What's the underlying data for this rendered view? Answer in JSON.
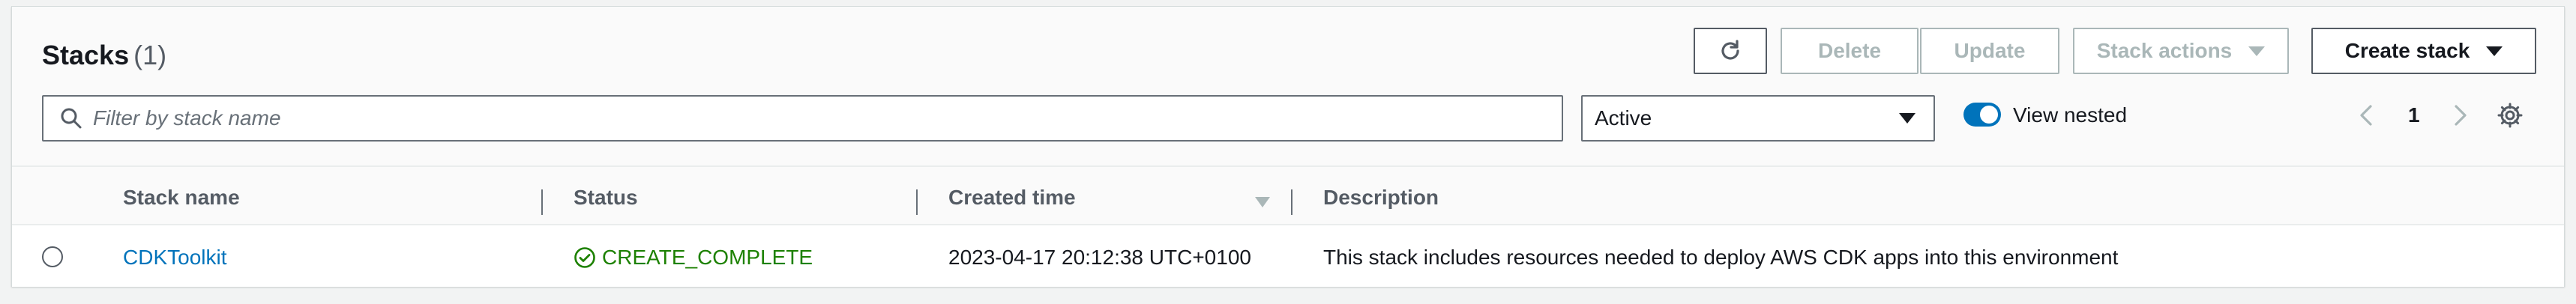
{
  "header": {
    "title": "Stacks",
    "count": "(1)"
  },
  "toolbar": {
    "refresh_icon": "refresh-icon",
    "delete_label": "Delete",
    "update_label": "Update",
    "stack_actions_label": "Stack actions",
    "create_stack_label": "Create stack"
  },
  "filter": {
    "placeholder": "Filter by stack name",
    "value": ""
  },
  "status_filter": {
    "selected": "Active"
  },
  "view_nested": {
    "label": "View nested",
    "enabled": true
  },
  "pagination": {
    "current_page": "1"
  },
  "table": {
    "columns": [
      "Stack name",
      "Status",
      "Created time",
      "Description"
    ],
    "rows": [
      {
        "stack_name": "CDKToolkit",
        "status": "CREATE_COMPLETE",
        "created_time": "2023-04-17 20:12:38 UTC+0100",
        "description": "This stack includes resources needed to deploy AWS CDK apps into this environment"
      }
    ]
  },
  "colors": {
    "link": "#0073bb",
    "success": "#1d8102",
    "toggle_on": "#0073bb"
  }
}
